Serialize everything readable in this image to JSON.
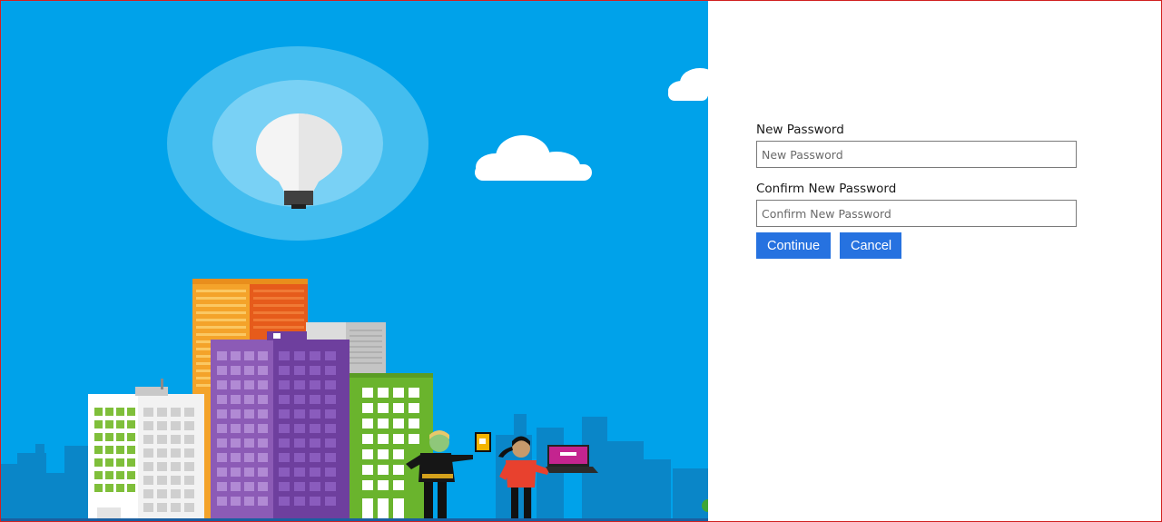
{
  "form": {
    "new_password": {
      "label": "New Password",
      "placeholder": "New Password",
      "value": ""
    },
    "confirm_password": {
      "label": "Confirm New Password",
      "placeholder": "Confirm New Password",
      "value": ""
    },
    "continue_label": "Continue",
    "cancel_label": "Cancel"
  },
  "illustration": {
    "icon": "lightbulb-icon",
    "colors": {
      "sky": "#00a2ea",
      "button": "#2672e0",
      "frame_border": "#d12020"
    }
  }
}
